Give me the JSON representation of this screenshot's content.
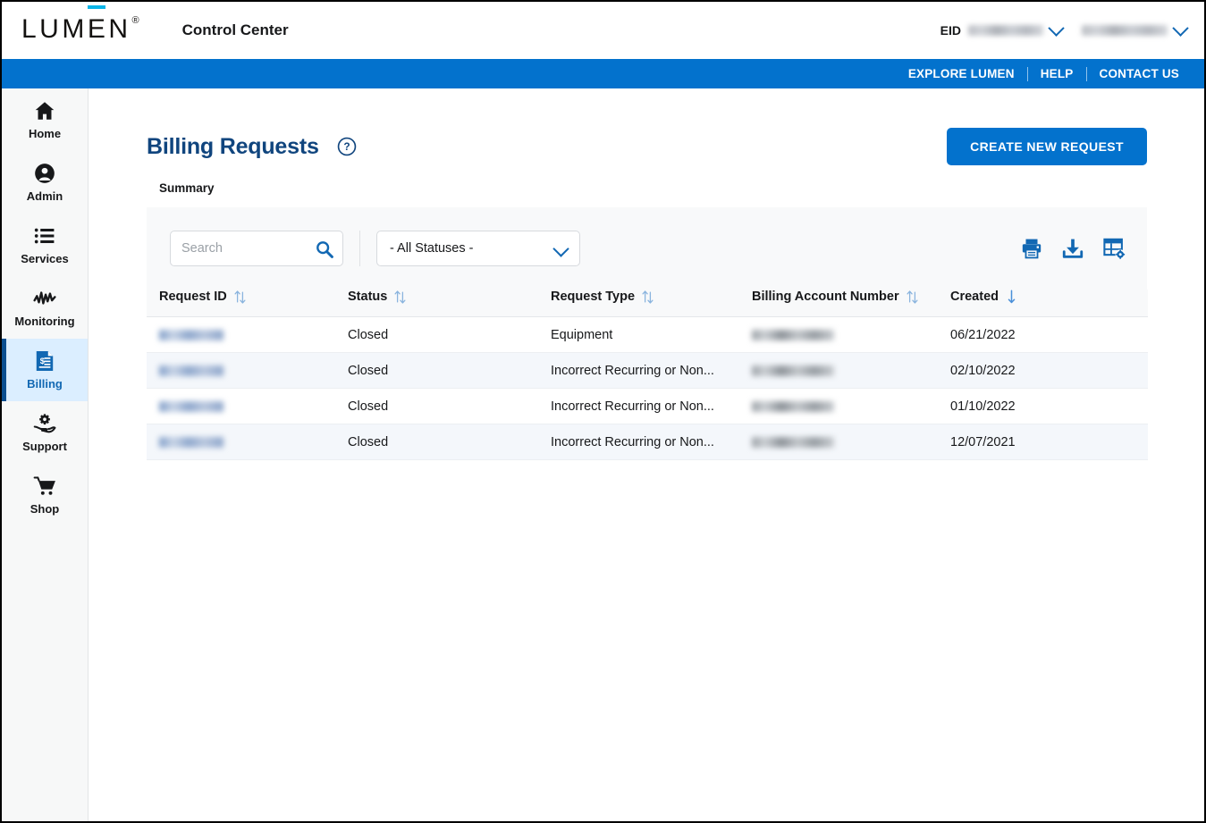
{
  "header": {
    "logo_text": "LUMEN",
    "logo_registered": "®",
    "app_name": "Control Center",
    "eid_label": "EID",
    "eid_value": "",
    "account_value": ""
  },
  "utility_nav": {
    "items": [
      {
        "label": "EXPLORE LUMEN",
        "icon": ""
      },
      {
        "label": "HELP",
        "icon": ""
      },
      {
        "label": "CONTACT US",
        "icon": ""
      }
    ]
  },
  "sidebar": {
    "items": [
      {
        "label": "Home",
        "icon": "home-icon",
        "active": false
      },
      {
        "label": "Admin",
        "icon": "user-circle-icon",
        "active": false
      },
      {
        "label": "Services",
        "icon": "list-icon",
        "active": false
      },
      {
        "label": "Monitoring",
        "icon": "waveform-icon",
        "active": false
      },
      {
        "label": "Billing",
        "icon": "invoice-dollar-icon",
        "active": true
      },
      {
        "label": "Support",
        "icon": "hand-gear-icon",
        "active": false
      },
      {
        "label": "Shop",
        "icon": "shopping-cart-icon",
        "active": false
      }
    ]
  },
  "page": {
    "title": "Billing Requests",
    "help_icon": "question-circle-icon",
    "create_button": "CREATE NEW REQUEST",
    "summary_label": "Summary"
  },
  "toolbar": {
    "search_placeholder": "Search",
    "search_value": "",
    "search_icon": "search-icon",
    "status_filter_value": "- All Statuses -",
    "status_filter_icon": "chevron-down-icon",
    "print_icon": "print-icon",
    "download_icon": "download-icon",
    "columns_icon": "table-settings-icon"
  },
  "table": {
    "columns": [
      {
        "label": "Request ID",
        "sort": "none"
      },
      {
        "label": "Status",
        "sort": "none"
      },
      {
        "label": "Request Type",
        "sort": "none"
      },
      {
        "label": "Billing Account Number",
        "sort": "none"
      },
      {
        "label": "Created",
        "sort": "desc"
      }
    ],
    "rows": [
      {
        "request_id": "",
        "status": "Closed",
        "request_type": "Equipment",
        "billing_account_number": "",
        "created": "06/21/2022"
      },
      {
        "request_id": "",
        "status": "Closed",
        "request_type": "Incorrect Recurring or Non...",
        "billing_account_number": "",
        "created": "02/10/2022"
      },
      {
        "request_id": "",
        "status": "Closed",
        "request_type": "Incorrect Recurring or Non...",
        "billing_account_number": "",
        "created": "01/10/2022"
      },
      {
        "request_id": "",
        "status": "Closed",
        "request_type": "Incorrect Recurring or Non...",
        "billing_account_number": "",
        "created": "12/07/2021"
      }
    ]
  },
  "colors": {
    "brand_blue": "#0372cd",
    "nav_blue": "#0372cd",
    "title_navy": "#10457e",
    "logo_accent": "#0bb5e8",
    "active_sidebar_bg": "#dbeeff",
    "active_sidebar_bar": "#0a4e8f",
    "row_alt": "#f4f7fb",
    "toolbar_bg": "#f8f9fa"
  }
}
